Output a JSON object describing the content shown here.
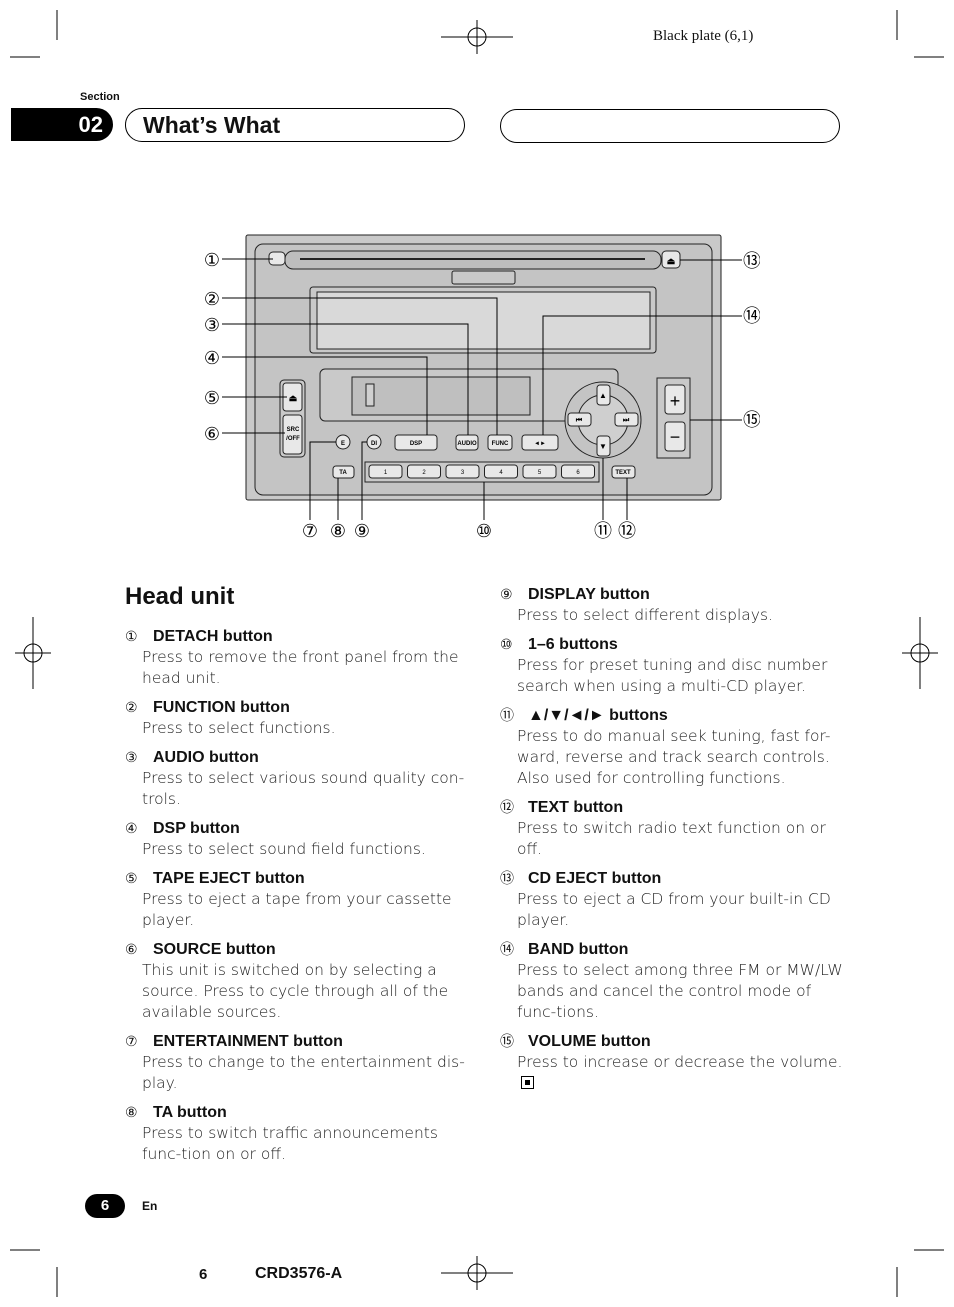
{
  "plate": "Black plate (6,1)",
  "section": {
    "label": "Section",
    "number": "02",
    "title": "What’s What"
  },
  "diagram": {
    "button_labels": {
      "src": "SRC",
      "off": "/OFF",
      "e": "E",
      "di": "DI",
      "dsp": "DSP",
      "audio": "AUDIO",
      "func": "FUNC",
      "band": "◄►",
      "ta": "TA",
      "presets": [
        "1",
        "2",
        "3",
        "4",
        "5",
        "6"
      ],
      "text": "TEXT",
      "plus": "+",
      "minus": "−",
      "eject": "⏏",
      "up": "▲",
      "down": "▼",
      "prev": "⏮",
      "next": "⏭"
    },
    "callouts": [
      "①",
      "②",
      "③",
      "④",
      "⑤",
      "⑥",
      "⑦",
      "⑧",
      "⑨",
      "⑩",
      "⑪",
      "⑫",
      "⑬",
      "⑭",
      "⑮"
    ]
  },
  "heading": "Head unit",
  "items": [
    {
      "num": "①",
      "title": "DETACH button",
      "desc": "Press to remove the front panel from the head unit."
    },
    {
      "num": "②",
      "title": "FUNCTION button",
      "desc": "Press to select functions."
    },
    {
      "num": "③",
      "title": "AUDIO button",
      "desc": "Press to select various sound quality con-trols."
    },
    {
      "num": "④",
      "title": "DSP button",
      "desc": "Press to select sound field functions."
    },
    {
      "num": "⑤",
      "title": "TAPE EJECT button",
      "desc": "Press to eject a tape from your cassette player."
    },
    {
      "num": "⑥",
      "title": "SOURCE button",
      "desc": "This unit is switched on by selecting a source. Press to cycle through all of the available sources."
    },
    {
      "num": "⑦",
      "title": "ENTERTAINMENT button",
      "desc": "Press to change to the entertainment dis-play."
    },
    {
      "num": "⑧",
      "title": "TA button",
      "desc": "Press to switch traffic announcements func-tion on or off."
    },
    {
      "num": "⑨",
      "title": "DISPLAY button",
      "desc": "Press to select different displays."
    },
    {
      "num": "⑩",
      "title": "1–6 buttons",
      "desc": "Press for preset tuning and disc number search when using a multi-CD player."
    },
    {
      "num": "⑪",
      "title": "▲/▼/◄/► buttons",
      "desc": "Press to do manual seek tuning, fast for-ward, reverse and track search controls. Also used for controlling functions."
    },
    {
      "num": "⑫",
      "title": "TEXT button",
      "desc": "Press to switch radio text function on or off."
    },
    {
      "num": "⑬",
      "title": "CD EJECT button",
      "desc": "Press to eject a CD from your built-in CD player."
    },
    {
      "num": "⑭",
      "title": "BAND button",
      "desc": "Press to select among three FM or MW/LW bands and cancel the control mode of func-tions."
    },
    {
      "num": "⑮",
      "title": "VOLUME button",
      "desc": "Press to increase or decrease the volume."
    }
  ],
  "footer": {
    "page": "6",
    "lang": "En",
    "bottom_page": "6",
    "code": "CRD3576-A"
  }
}
